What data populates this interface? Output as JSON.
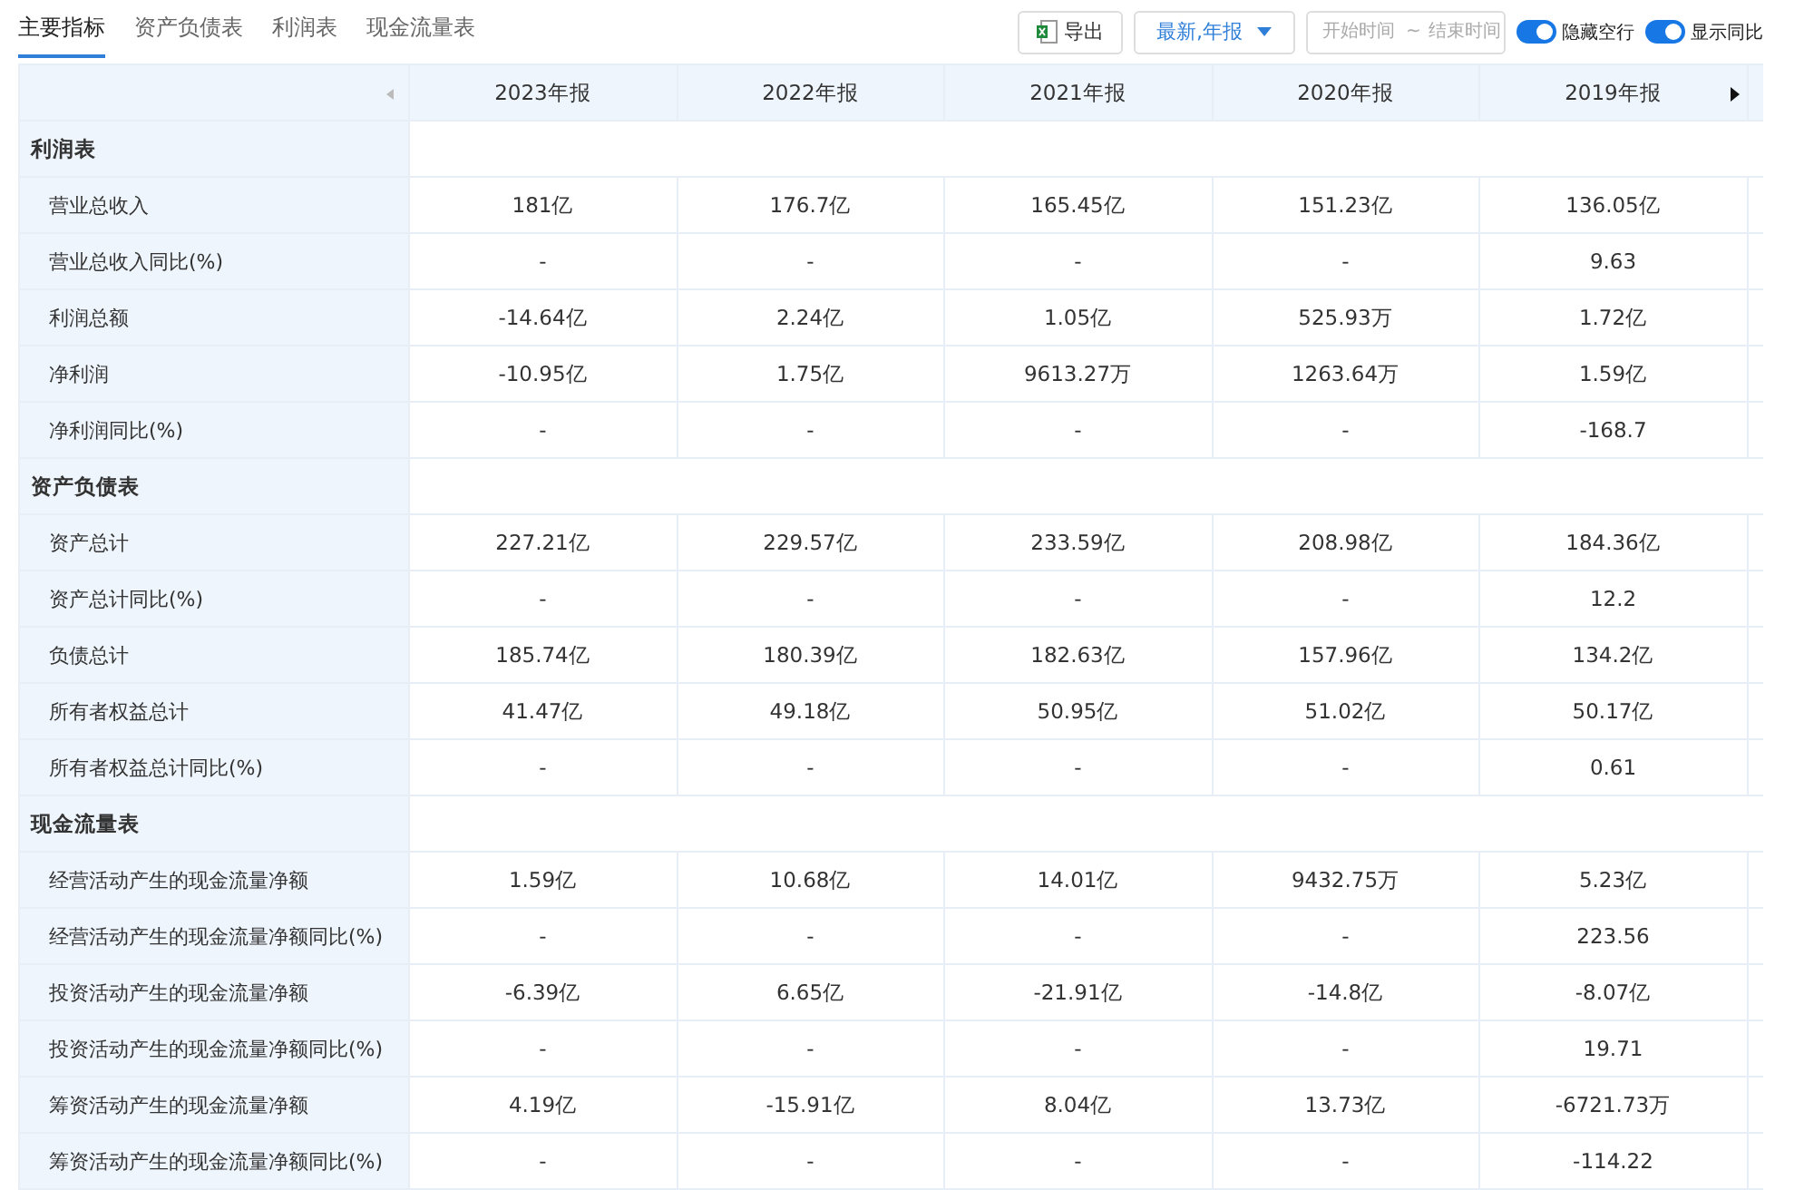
{
  "tabs": [
    {
      "label": "主要指标",
      "selected": true
    },
    {
      "label": "资产负债表",
      "selected": false
    },
    {
      "label": "利润表",
      "selected": false
    },
    {
      "label": "现金流量表",
      "selected": false
    }
  ],
  "toolbar": {
    "export_button": "导出",
    "period_dropdown": "最新,年报",
    "date_range": {
      "start_placeholder": "开始时间",
      "separator": "~",
      "end_placeholder": "结束时间"
    },
    "toggles": [
      {
        "label": "隐藏空行",
        "on": true
      },
      {
        "label": "显示同比",
        "on": true
      }
    ]
  },
  "table": {
    "columns": [
      "2023年报",
      "2022年报",
      "2021年报",
      "2020年报",
      "2019年报"
    ],
    "sections": [
      {
        "title": "利润表",
        "rows": [
          {
            "label": "营业总收入",
            "values": [
              "181亿",
              "176.7亿",
              "165.45亿",
              "151.23亿",
              "136.05亿"
            ]
          },
          {
            "label": "营业总收入同比(%)",
            "values": [
              "-",
              "-",
              "-",
              "-",
              "9.63"
            ]
          },
          {
            "label": "利润总额",
            "values": [
              "-14.64亿",
              "2.24亿",
              "1.05亿",
              "525.93万",
              "1.72亿"
            ]
          },
          {
            "label": "净利润",
            "values": [
              "-10.95亿",
              "1.75亿",
              "9613.27万",
              "1263.64万",
              "1.59亿"
            ]
          },
          {
            "label": "净利润同比(%)",
            "values": [
              "-",
              "-",
              "-",
              "-",
              "-168.7"
            ]
          }
        ]
      },
      {
        "title": "资产负债表",
        "rows": [
          {
            "label": "资产总计",
            "values": [
              "227.21亿",
              "229.57亿",
              "233.59亿",
              "208.98亿",
              "184.36亿"
            ]
          },
          {
            "label": "资产总计同比(%)",
            "values": [
              "-",
              "-",
              "-",
              "-",
              "12.2"
            ]
          },
          {
            "label": "负债总计",
            "values": [
              "185.74亿",
              "180.39亿",
              "182.63亿",
              "157.96亿",
              "134.2亿"
            ]
          },
          {
            "label": "所有者权益总计",
            "values": [
              "41.47亿",
              "49.18亿",
              "50.95亿",
              "51.02亿",
              "50.17亿"
            ]
          },
          {
            "label": "所有者权益总计同比(%)",
            "values": [
              "-",
              "-",
              "-",
              "-",
              "0.61"
            ]
          }
        ]
      },
      {
        "title": "现金流量表",
        "rows": [
          {
            "label": "经营活动产生的现金流量净额",
            "values": [
              "1.59亿",
              "10.68亿",
              "14.01亿",
              "9432.75万",
              "5.23亿"
            ]
          },
          {
            "label": "经营活动产生的现金流量净额同比(%)",
            "values": [
              "-",
              "-",
              "-",
              "-",
              "223.56"
            ]
          },
          {
            "label": "投资活动产生的现金流量净额",
            "values": [
              "-6.39亿",
              "6.65亿",
              "-21.91亿",
              "-14.8亿",
              "-8.07亿"
            ]
          },
          {
            "label": "投资活动产生的现金流量净额同比(%)",
            "values": [
              "-",
              "-",
              "-",
              "-",
              "19.71"
            ]
          },
          {
            "label": "筹资活动产生的现金流量净额",
            "values": [
              "4.19亿",
              "-15.91亿",
              "8.04亿",
              "13.73亿",
              "-6721.73万"
            ]
          },
          {
            "label": "筹资活动产生的现金流量净额同比(%)",
            "values": [
              "-",
              "-",
              "-",
              "-",
              "-114.22"
            ]
          }
        ]
      }
    ]
  }
}
